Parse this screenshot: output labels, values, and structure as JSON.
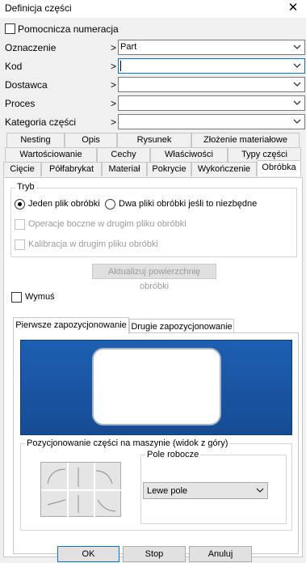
{
  "window": {
    "title": "Definicja części",
    "close_label": "✕"
  },
  "aux_numbering_label": "Pomocnicza numeracja",
  "fields": [
    {
      "label": "Oznaczenie",
      "value": "Part"
    },
    {
      "label": "Kod",
      "value": ""
    },
    {
      "label": "Dostawca",
      "value": ""
    },
    {
      "label": "Proces",
      "value": ""
    },
    {
      "label": "Kategoria części",
      "value": ""
    }
  ],
  "chevron": ">",
  "tabs_row1": [
    "Nesting",
    "Opis",
    "Rysunek",
    "Złożenie materiałowe"
  ],
  "tabs_row2": [
    "Wartościowanie",
    "Cechy",
    "Właściwości",
    "Typy części"
  ],
  "tabs_row3": [
    "Cięcie",
    "Półfabrykat",
    "Materiał",
    "Pokrycie",
    "Wykończenie",
    "Obróbka"
  ],
  "active_tab": "Obróbka",
  "mode": {
    "group_title": "Tryb",
    "radio1": "Jeden plik obróbki",
    "radio2": "Dwa pliki obróbki jeśli to niezbędne",
    "check1": "Operacje boczne w drugim pliku obróbki",
    "check2": "Kalibracja w drugim pliku obróbki"
  },
  "update_button": "Aktualizuj powierzchnię obróbki",
  "force_label": "Wymuś",
  "subtabs": [
    "Pierwsze zapozycjonowanie",
    "Drugie zapozycjonowanie"
  ],
  "positioning_group_title": "Pozycjonowanie części na maszynie (widok z góry)",
  "work_field": {
    "group_title": "Pole robocze",
    "value": "Lewe pole"
  },
  "buttons": {
    "ok": "OK",
    "stop": "Stop",
    "cancel": "Anuluj"
  },
  "colors": {
    "accent": "#0078d7",
    "preview_bg": "#1e5fb1"
  }
}
